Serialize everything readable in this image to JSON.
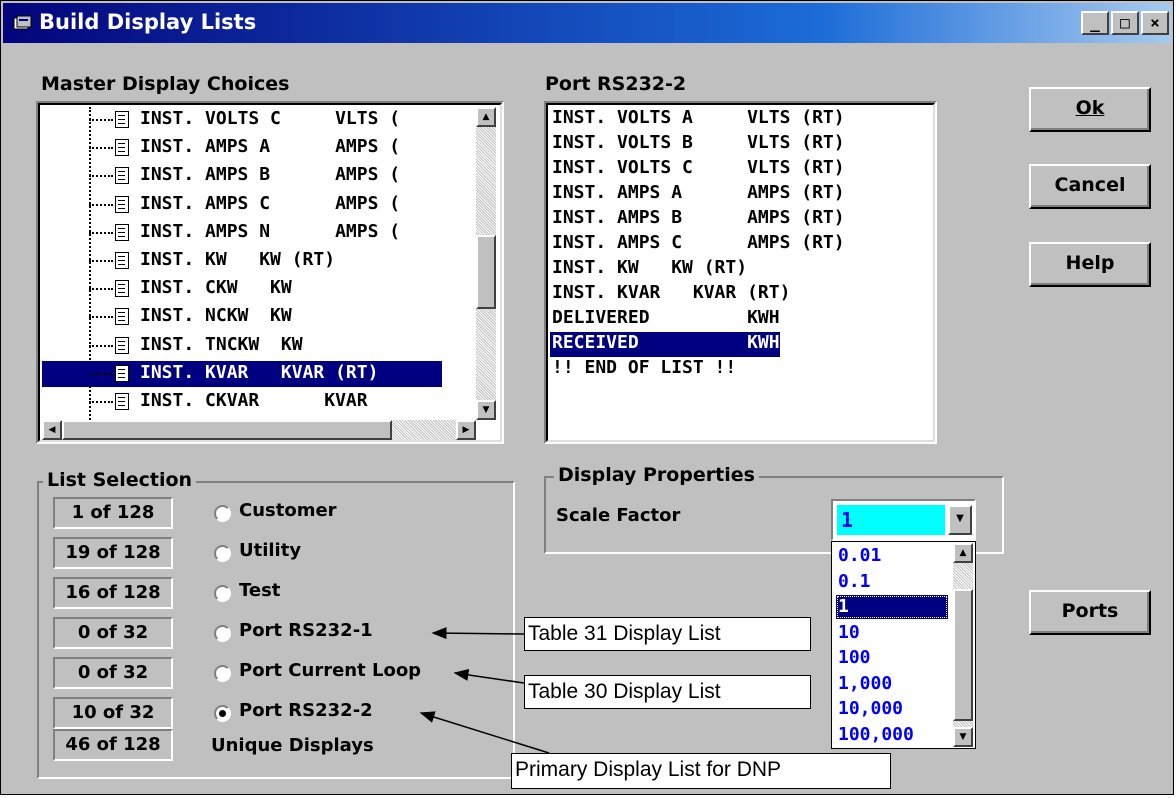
{
  "window": {
    "title": "Build Display Lists",
    "controls": {
      "minimize": "_",
      "maximize": "□",
      "close": "×"
    }
  },
  "master": {
    "label": "Master Display Choices",
    "items": [
      "INST. VOLTS C     VLTS (",
      "INST. AMPS A      AMPS (",
      "INST. AMPS B      AMPS (",
      "INST. AMPS C      AMPS (",
      "INST. AMPS N      AMPS (",
      "INST. KW   KW (RT)",
      "INST. CKW   KW",
      "INST. NCKW  KW",
      "INST. TNCKW  KW",
      "INST. KVAR   KVAR (RT)",
      "INST. CKVAR      KVAR"
    ],
    "selected_index": 9
  },
  "port": {
    "label": "Port RS232-2",
    "items": [
      "INST. VOLTS A     VLTS (RT)",
      "INST. VOLTS B     VLTS (RT)",
      "INST. VOLTS C     VLTS (RT)",
      "INST. AMPS A      AMPS (RT)",
      "INST. AMPS B      AMPS (RT)",
      "INST. AMPS C      AMPS (RT)",
      "INST. KW   KW (RT)",
      "INST. KVAR   KVAR (RT)",
      "DELIVERED         KWH",
      "RECEIVED          KWH",
      "!! END OF LIST !!"
    ],
    "selected_index": 9
  },
  "buttons": {
    "ok": "Ok",
    "cancel": "Cancel",
    "help": "Help",
    "ports": "Ports"
  },
  "list_selection": {
    "title": "List Selection",
    "rows": [
      {
        "count": "1 of 128",
        "label": "Customer",
        "checked": false
      },
      {
        "count": "19 of 128",
        "label": "Utility",
        "checked": false
      },
      {
        "count": "16 of 128",
        "label": "Test",
        "checked": false
      },
      {
        "count": "0 of 32",
        "label": "Port RS232-1",
        "checked": false
      },
      {
        "count": "0 of 32",
        "label": "Port Current Loop",
        "checked": false
      },
      {
        "count": "10 of 32",
        "label": "Port RS232-2",
        "checked": true
      }
    ],
    "unique": {
      "count": "46 of 128",
      "label": "Unique Displays"
    }
  },
  "display_properties": {
    "title": "Display Properties",
    "scale_label": "Scale Factor",
    "scale_value": "1",
    "options": [
      "0.01",
      "0.1",
      "1",
      "10",
      "100",
      "1,000",
      "10,000",
      "100,000"
    ],
    "selected_index": 2
  },
  "callouts": {
    "table31": "Table 31 Display List",
    "table30": "Table 30 Display List",
    "primary": "Primary Display List for DNP"
  }
}
